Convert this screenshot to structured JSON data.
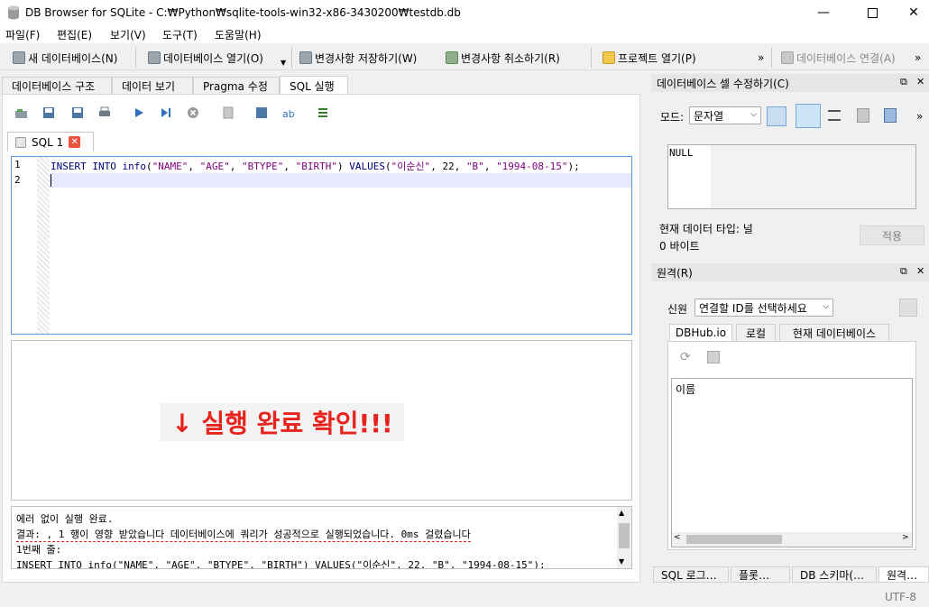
{
  "window": {
    "title": "DB Browser for SQLite - C:₩Python₩sqlite-tools-win32-x86-3430200₩testdb.db"
  },
  "menu": [
    "파일(F)",
    "편집(E)",
    "보기(V)",
    "도구(T)",
    "도움말(H)"
  ],
  "toolbar": {
    "new_db": "새 데이터베이스(N)",
    "open_db": "데이터베이스 열기(O)",
    "write_changes": "변경사항 저장하기(W)",
    "revert_changes": "변경사항 취소하기(R)",
    "open_project": "프로젝트 열기(P)",
    "connect_db": "데이터베이스 연결(A)",
    "more": "»"
  },
  "main_tabs": [
    "데이터베이스 구조",
    "데이터 보기",
    "Pragma 수정",
    "SQL 실행"
  ],
  "sql_tab": {
    "label": "SQL 1"
  },
  "editor": {
    "line_numbers": [
      "1",
      "2"
    ],
    "line1": {
      "kw1": "INSERT INTO",
      "table": "info",
      "p1": "(",
      "c1": "\"NAME\"",
      "c2": "\"AGE\"",
      "c3": "\"BTYPE\"",
      "c4": "\"BIRTH\"",
      "p2": ")",
      "kw2": "VALUES",
      "v1": "\"이순신\"",
      "v2": "22",
      "v3": "\"B\"",
      "v4": "\"1994-08-15\"",
      "end": ");"
    }
  },
  "annotation": "↓ 실행 완료 확인!!!",
  "messages": {
    "line1": "에러 없이 실행 완료.",
    "line2": "결과: , 1 행이 영향 받았습니다 데이터베이스에 쿼리가 성공적으로 실행되었습니다. 0ms 걸렸습니다",
    "line3": "1번째 줄:",
    "line4": "INSERT INTO info(\"NAME\", \"AGE\", \"BTYPE\", \"BIRTH\") VALUES(\"이순신\", 22, \"B\", \"1994-08-15\");"
  },
  "edit_cell": {
    "title": "데이터베이스 셀 수정하기(C)",
    "mode_label": "모드:",
    "mode_value": "문자열",
    "cell_value": "NULL",
    "type_label": "현재 데이터 타입: 널",
    "size_label": "0 바이트",
    "apply": "적용"
  },
  "remote": {
    "title": "원격(R)",
    "identity_label": "신원",
    "identity_value": "연결할 ID를 선택하세요",
    "tabs": [
      "DBHub.io",
      "로컬",
      "현재 데이터베이스"
    ],
    "list_header": "이름"
  },
  "bottom_tabs": [
    "SQL 로그…",
    "플롯…",
    "DB 스키마(…",
    "원격…"
  ],
  "status": {
    "encoding": "UTF-8"
  },
  "colors": {
    "annotation": "#e8231e",
    "editor_border": "#569de5",
    "keyword": "#00007f",
    "string": "#7f007f"
  }
}
